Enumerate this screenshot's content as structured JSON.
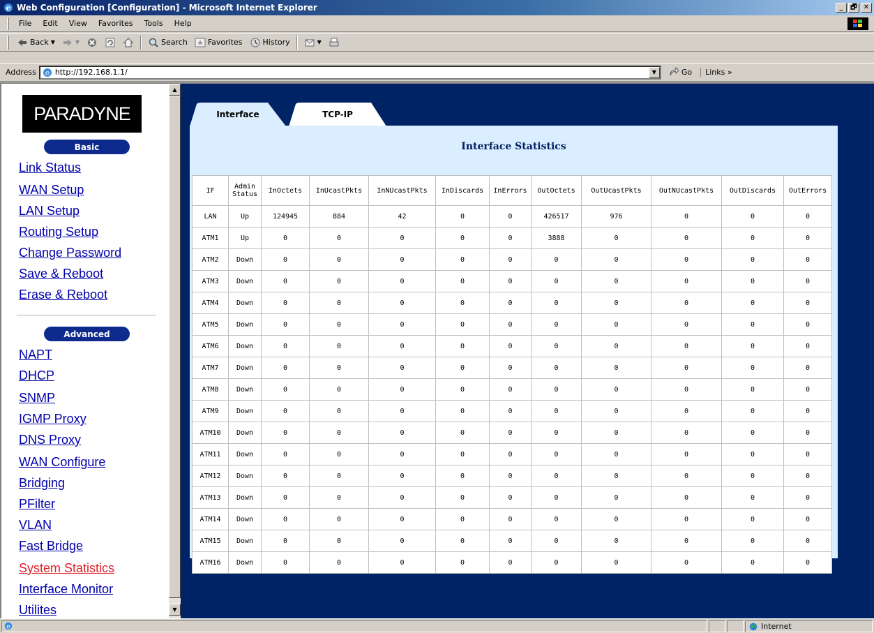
{
  "window": {
    "title": "Web Configuration [Configuration] - Microsoft Internet Explorer",
    "min": "_",
    "max": "🗗",
    "close": "✕"
  },
  "menu": [
    "File",
    "Edit",
    "View",
    "Favorites",
    "Tools",
    "Help"
  ],
  "toolbar": {
    "back": "Back",
    "search": "Search",
    "favorites": "Favorites",
    "history": "History"
  },
  "address": {
    "label": "Address",
    "url": "http://192.168.1.1/",
    "go": "Go",
    "links": "Links »"
  },
  "sidebar": {
    "logo": "PARADYNE",
    "basic_label": "Basic",
    "basic_items": [
      "Link Status",
      "WAN Setup",
      "LAN Setup",
      "Routing Setup",
      "Change Password",
      "Save & Reboot",
      "Erase & Reboot"
    ],
    "advanced_label": "Advanced",
    "advanced_items": [
      "NAPT",
      "DHCP",
      "SNMP",
      "IGMP Proxy",
      "DNS Proxy",
      "WAN Configure",
      "Bridging",
      "PFilter",
      "VLAN",
      "Fast Bridge",
      "System Statistics",
      "Interface Monitor",
      "Utilites"
    ],
    "active_item": "System Statistics"
  },
  "tabs": [
    {
      "label": "Interface",
      "active": true
    },
    {
      "label": "TCP-IP",
      "active": false
    }
  ],
  "panel": {
    "title": "Interface Statistics",
    "columns": [
      "IF",
      "Admin Status",
      "InOctets",
      "InUcastPkts",
      "InNUcastPkts",
      "InDiscards",
      "InErrors",
      "OutOctets",
      "OutUcastPkts",
      "OutNUcastPkts",
      "OutDiscards",
      "OutErrors"
    ],
    "rows": [
      [
        "LAN",
        "Up",
        "124945",
        "884",
        "42",
        "0",
        "0",
        "426517",
        "976",
        "0",
        "0",
        "0"
      ],
      [
        "ATM1",
        "Up",
        "0",
        "0",
        "0",
        "0",
        "0",
        "3888",
        "0",
        "0",
        "0",
        "0"
      ],
      [
        "ATM2",
        "Down",
        "0",
        "0",
        "0",
        "0",
        "0",
        "0",
        "0",
        "0",
        "0",
        "0"
      ],
      [
        "ATM3",
        "Down",
        "0",
        "0",
        "0",
        "0",
        "0",
        "0",
        "0",
        "0",
        "0",
        "0"
      ],
      [
        "ATM4",
        "Down",
        "0",
        "0",
        "0",
        "0",
        "0",
        "0",
        "0",
        "0",
        "0",
        "0"
      ],
      [
        "ATM5",
        "Down",
        "0",
        "0",
        "0",
        "0",
        "0",
        "0",
        "0",
        "0",
        "0",
        "0"
      ],
      [
        "ATM6",
        "Down",
        "0",
        "0",
        "0",
        "0",
        "0",
        "0",
        "0",
        "0",
        "0",
        "0"
      ],
      [
        "ATM7",
        "Down",
        "0",
        "0",
        "0",
        "0",
        "0",
        "0",
        "0",
        "0",
        "0",
        "0"
      ],
      [
        "ATM8",
        "Down",
        "0",
        "0",
        "0",
        "0",
        "0",
        "0",
        "0",
        "0",
        "0",
        "0"
      ],
      [
        "ATM9",
        "Down",
        "0",
        "0",
        "0",
        "0",
        "0",
        "0",
        "0",
        "0",
        "0",
        "0"
      ],
      [
        "ATM10",
        "Down",
        "0",
        "0",
        "0",
        "0",
        "0",
        "0",
        "0",
        "0",
        "0",
        "0"
      ],
      [
        "ATM11",
        "Down",
        "0",
        "0",
        "0",
        "0",
        "0",
        "0",
        "0",
        "0",
        "0",
        "0"
      ],
      [
        "ATM12",
        "Down",
        "0",
        "0",
        "0",
        "0",
        "0",
        "0",
        "0",
        "0",
        "0",
        "0"
      ],
      [
        "ATM13",
        "Down",
        "0",
        "0",
        "0",
        "0",
        "0",
        "0",
        "0",
        "0",
        "0",
        "0"
      ],
      [
        "ATM14",
        "Down",
        "0",
        "0",
        "0",
        "0",
        "0",
        "0",
        "0",
        "0",
        "0",
        "0"
      ],
      [
        "ATM15",
        "Down",
        "0",
        "0",
        "0",
        "0",
        "0",
        "0",
        "0",
        "0",
        "0",
        "0"
      ],
      [
        "ATM16",
        "Down",
        "0",
        "0",
        "0",
        "0",
        "0",
        "0",
        "0",
        "0",
        "0",
        "0"
      ]
    ]
  },
  "statusbar": {
    "zone": "Internet"
  },
  "colors": {
    "page_bg": "#002366",
    "panel_bg": "#dbeeff",
    "pill": "#0d2a8c",
    "link": "#0000aa",
    "active_link": "#e0202a"
  }
}
